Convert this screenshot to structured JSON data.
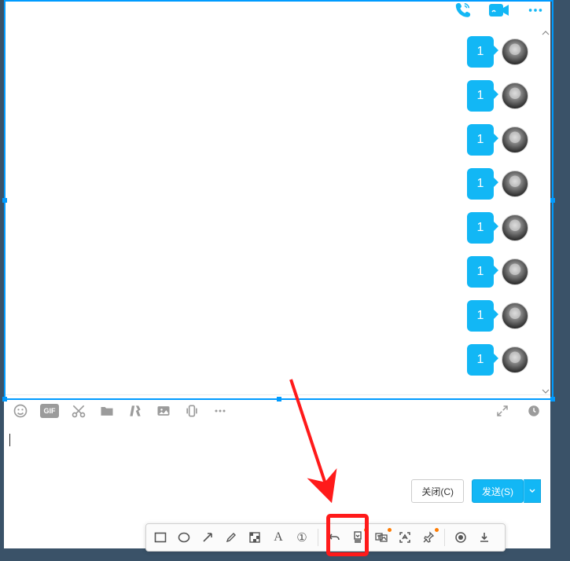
{
  "header": {
    "voice_call": "voice-call",
    "video_call": "video-call",
    "more": "more"
  },
  "messages": [
    {
      "text": "1"
    },
    {
      "text": "1"
    },
    {
      "text": "1"
    },
    {
      "text": "1"
    },
    {
      "text": "1"
    },
    {
      "text": "1"
    },
    {
      "text": "1"
    },
    {
      "text": "1"
    }
  ],
  "input_toolbar": {
    "gif_label": "GIF"
  },
  "buttons": {
    "close": "关闭(C)",
    "send": "发送(S)"
  },
  "snip_toolbar": {
    "text_label": "A",
    "serial_label": "①"
  }
}
